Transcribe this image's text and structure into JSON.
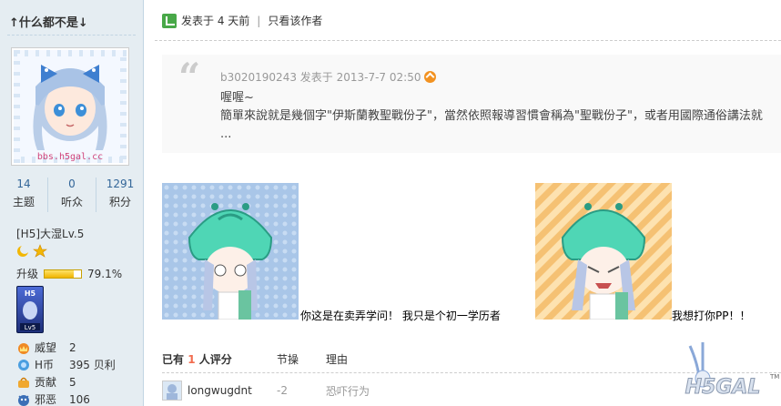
{
  "user": {
    "name": "↑什么都不是↓",
    "stats": [
      {
        "num": "14",
        "label": "主题"
      },
      {
        "num": "0",
        "label": "听众"
      },
      {
        "num": "1291",
        "label": "积分"
      }
    ],
    "level": "[H5]大湿Lv.5",
    "upgrade_label": "升级",
    "upgrade_percent": "79.1%",
    "upgrade_fraction": 0.791,
    "avatar_text": "bbs.h5gal.cc",
    "credits": [
      {
        "icon": "crown-icon",
        "key": "威望",
        "value": "2"
      },
      {
        "icon": "coin-icon",
        "key": "H币",
        "value": "395 贝利"
      },
      {
        "icon": "contribution-icon",
        "key": "贡献",
        "value": "5"
      },
      {
        "icon": "evil-icon",
        "key": "邪恶",
        "value": "106"
      }
    ]
  },
  "post": {
    "posted": "发表于 4 天前",
    "only_author": "只看该作者"
  },
  "quote": {
    "head": "b3020190243 发表于 2013-7-7 02:50",
    "line1": "喔喔~",
    "line2": "簡單來說就是幾個字\"伊斯蘭教聖戰份子\"，當然依照報導習慣會稱為\"聖戰份子\"，或者用國際通俗講法就 ..."
  },
  "captions": {
    "first": "你这是在卖弄学问！ 我只是个初一学历者",
    "second": "我想打你PP！！"
  },
  "rating": {
    "prefix": "已有",
    "count": "1",
    "suffix": "人评分",
    "col2": "节操",
    "col3": "理由",
    "rows": [
      {
        "user": "longwugdnt",
        "score": "-2",
        "reason": "恐吓行为"
      }
    ]
  },
  "logo_text": "H5GAL",
  "colors": {
    "sidebar_bg": "#e5edf2",
    "link_blue": "#336699",
    "count_red": "#f26c4f",
    "quote_bg": "#f9f9f9"
  }
}
